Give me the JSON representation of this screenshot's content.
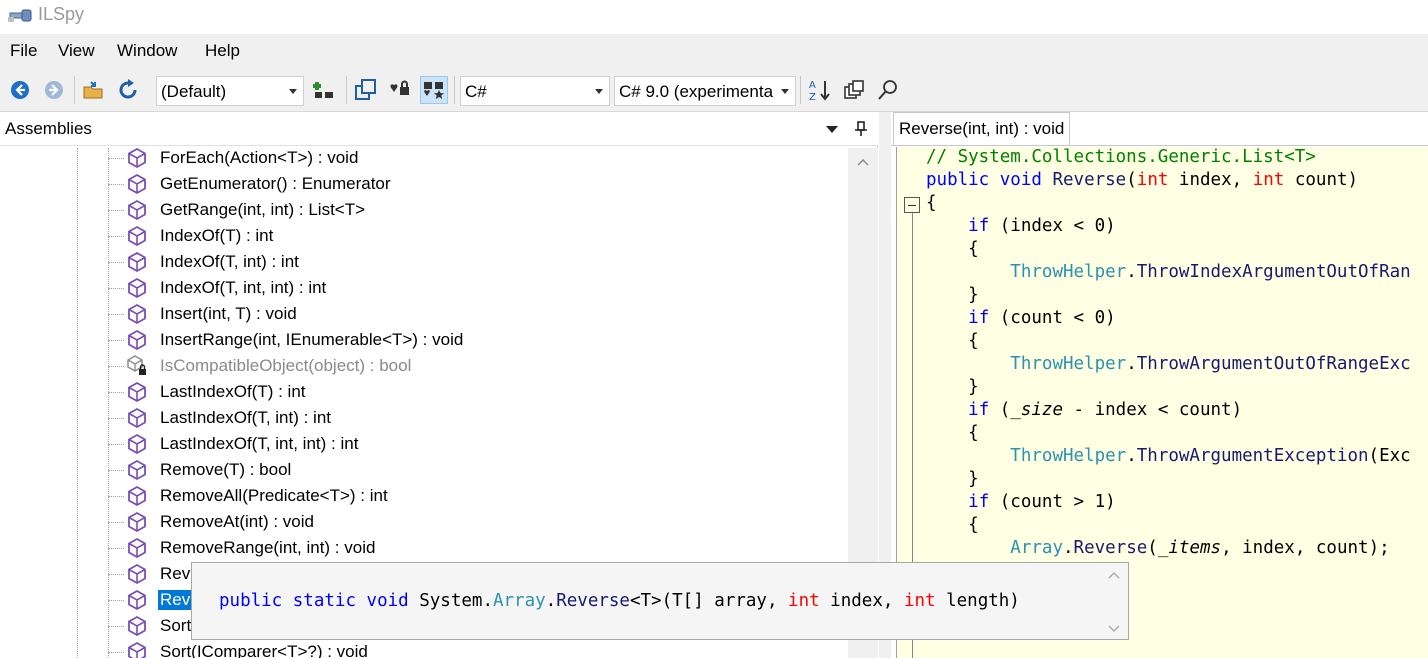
{
  "window": {
    "title": "ILSpy"
  },
  "menu": [
    "File",
    "View",
    "Window",
    "Help"
  ],
  "toolbar": {
    "assembly_list": "(Default)",
    "language": "C#",
    "language_version": "C# 9.0 (experimenta"
  },
  "assemblies_pane": {
    "title": "Assemblies",
    "items": [
      {
        "label": "ForEach(Action<T>) : void",
        "icon": "method-icon"
      },
      {
        "label": "GetEnumerator() : Enumerator",
        "icon": "method-icon"
      },
      {
        "label": "GetRange(int, int) : List<T>",
        "icon": "method-icon"
      },
      {
        "label": "IndexOf(T) : int",
        "icon": "method-icon"
      },
      {
        "label": "IndexOf(T, int) : int",
        "icon": "method-icon"
      },
      {
        "label": "IndexOf(T, int, int) : int",
        "icon": "method-icon"
      },
      {
        "label": "Insert(int, T) : void",
        "icon": "method-icon"
      },
      {
        "label": "InsertRange(int, IEnumerable<T>) : void",
        "icon": "method-icon"
      },
      {
        "label": "IsCompatibleObject(object) : bool",
        "icon": "private-method-icon"
      },
      {
        "label": "LastIndexOf(T) : int",
        "icon": "method-icon"
      },
      {
        "label": "LastIndexOf(T, int) : int",
        "icon": "method-icon"
      },
      {
        "label": "LastIndexOf(T, int, int) : int",
        "icon": "method-icon"
      },
      {
        "label": "Remove(T) : bool",
        "icon": "method-icon"
      },
      {
        "label": "RemoveAll(Predicate<T>) : int",
        "icon": "method-icon"
      },
      {
        "label": "RemoveAt(int) : void",
        "icon": "method-icon"
      },
      {
        "label": "RemoveRange(int, int) : void",
        "icon": "method-icon"
      },
      {
        "label": "Reve",
        "icon": "method-icon"
      },
      {
        "label": "Reve",
        "icon": "method-icon"
      },
      {
        "label": "Sort",
        "icon": "method-icon"
      },
      {
        "label": "Sort(IComparer<T>?) : void",
        "icon": "method-icon"
      }
    ]
  },
  "editor": {
    "tab_title": "Reverse(int, int) : void",
    "lines": [
      "// System.Collections.Generic.List<T>",
      "public void Reverse(int index, int count)",
      "{",
      "    if (index < 0)",
      "    {",
      "        ThrowHelper.ThrowIndexArgumentOutOfRan",
      "    }",
      "    if (count < 0)",
      "    {",
      "        ThrowHelper.ThrowArgumentOutOfRangeExc",
      "    }",
      "    if (_size - index < count)",
      "    {",
      "        ThrowHelper.ThrowArgumentException(Exc",
      "    }",
      "    if (count > 1)",
      "    {",
      "        Array.Reverse(_items, index, count);"
    ]
  },
  "tooltip": {
    "signature": "public static void System.Array.Reverse<T>(T[] array, int index, int length)"
  },
  "colors": {
    "selection": "#0078d7",
    "editor_background": "#ffffe3",
    "keyword": "#0000ff",
    "value_type_keyword": "#ff0000",
    "comment": "#008000",
    "type_name": "#2b91af",
    "method_icon": "#7a4fb3"
  }
}
